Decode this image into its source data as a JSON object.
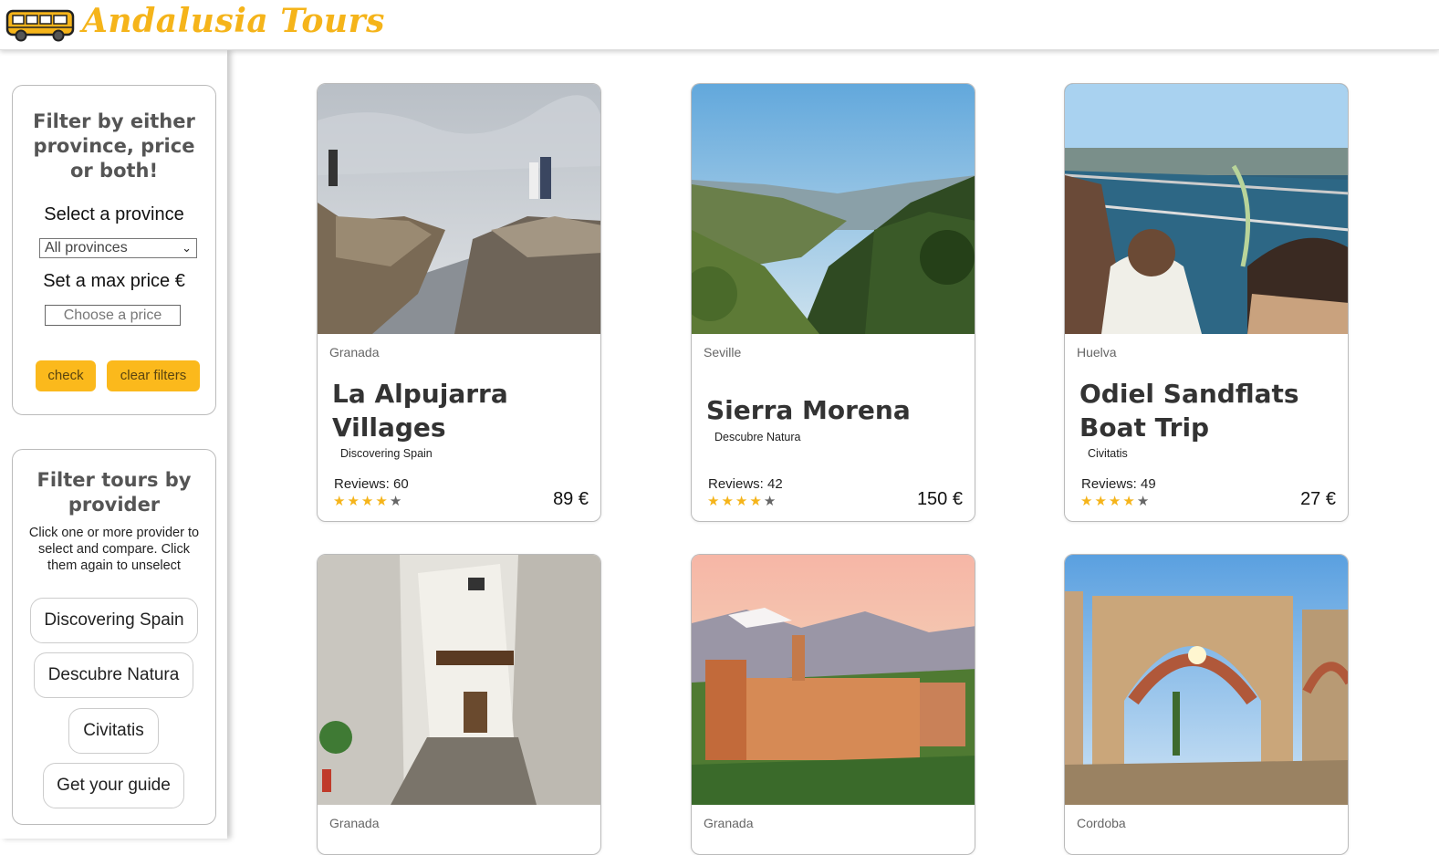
{
  "header": {
    "brand": "Andalusia Tours",
    "logo_icon": "bus-icon",
    "accent": "#f5b41a"
  },
  "filters": {
    "title": "Filter by either province, price or both!",
    "province_label": "Select a province",
    "province_selected": "All provinces",
    "price_label": "Set a max price €",
    "price_placeholder": "Choose a price",
    "check_label": "check",
    "clear_label": "clear filters"
  },
  "providers": {
    "title": "Filter tours by provider",
    "description": "Click one or more provider to select and compare. Click them again to unselect",
    "items": [
      {
        "label": "Discovering Spain"
      },
      {
        "label": "Descubre Natura"
      },
      {
        "label": "Civitatis"
      },
      {
        "label": "Get your guide"
      }
    ]
  },
  "tours": [
    {
      "province": "Granada",
      "title": "La Alpujarra Villages",
      "provider": "Discovering Spain",
      "reviews": "Reviews: 60",
      "rating": 4,
      "price": "89 €",
      "image": "mountain-cliff-photo"
    },
    {
      "province": "Seville",
      "title": "Sierra Morena",
      "provider": "Descubre Natura",
      "reviews": "Reviews: 42",
      "rating": 4,
      "price": "150 €",
      "image": "valley-landscape-photo"
    },
    {
      "province": "Huelva",
      "title": "Odiel Sandflats Boat Trip",
      "provider": "Civitatis",
      "reviews": "Reviews: 49",
      "rating": 4,
      "price": "27 €",
      "image": "boat-trip-photo"
    },
    {
      "province": "Granada",
      "image": "white-village-street-photo"
    },
    {
      "province": "Granada",
      "image": "alhambra-photo"
    },
    {
      "province": "Cordoba",
      "image": "medina-azahara-arch-photo"
    }
  ]
}
